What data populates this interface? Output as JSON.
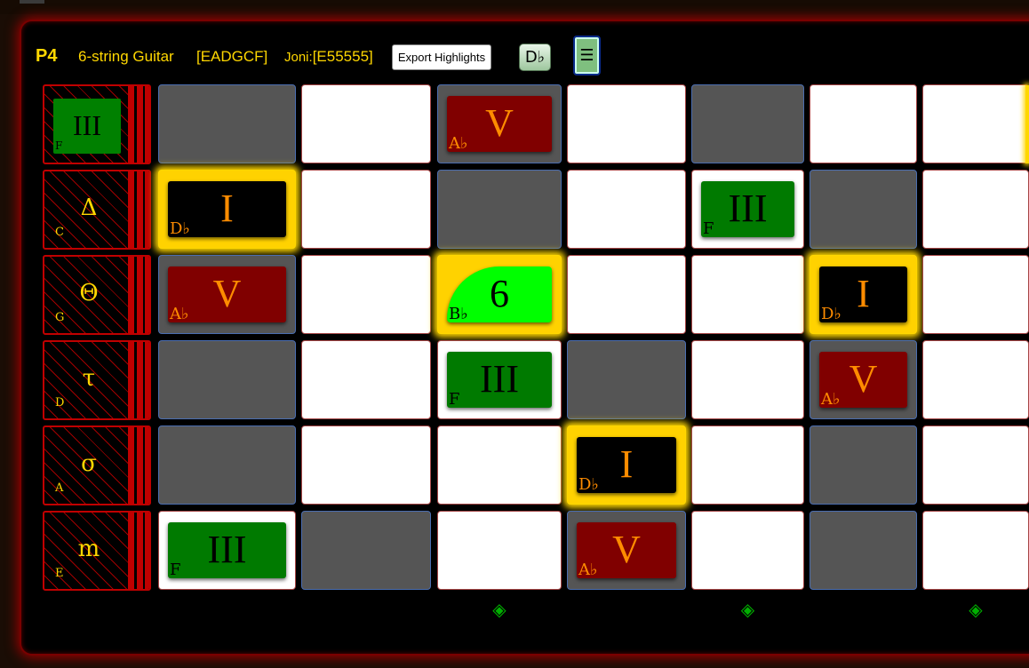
{
  "header": {
    "position": "P4",
    "instrument": "6-string Guitar",
    "tuning": "[EADGCF]",
    "joni_label": "Joni:",
    "joni_value": "[E55555]",
    "export_label": "Export Highlights",
    "key_label": "D♭",
    "menu_label": "☰"
  },
  "strings": [
    {
      "symbol": "",
      "note": "F",
      "chip": {
        "numeral": "III",
        "note": "F"
      }
    },
    {
      "symbol": "Δ",
      "note": "C"
    },
    {
      "symbol": "Θ",
      "note": "G"
    },
    {
      "symbol": "τ",
      "note": "D"
    },
    {
      "symbol": "σ",
      "note": "A"
    },
    {
      "symbol": "m",
      "note": "E"
    }
  ],
  "grid": [
    [
      {
        "bg": "gray"
      },
      {
        "bg": "white"
      },
      {
        "bg": "gray",
        "chip": {
          "kind": "red",
          "numeral": "V",
          "note": "A♭"
        }
      },
      {
        "bg": "white"
      },
      {
        "bg": "gray"
      },
      {
        "bg": "white"
      },
      {
        "bg": "white"
      }
    ],
    [
      {
        "bg": "glow",
        "chip": {
          "kind": "black",
          "numeral": "I",
          "note": "D♭"
        }
      },
      {
        "bg": "white"
      },
      {
        "bg": "gray"
      },
      {
        "bg": "white"
      },
      {
        "bg": "white",
        "chip": {
          "kind": "green",
          "numeral": "III",
          "note": "F"
        }
      },
      {
        "bg": "gray"
      },
      {
        "bg": "white"
      }
    ],
    [
      {
        "bg": "gray",
        "chip": {
          "kind": "red",
          "numeral": "V",
          "note": "A♭"
        }
      },
      {
        "bg": "white"
      },
      {
        "bg": "glow",
        "chip": {
          "kind": "lime",
          "numeral": "6",
          "note": "B♭"
        }
      },
      {
        "bg": "white"
      },
      {
        "bg": "white"
      },
      {
        "bg": "glow",
        "chip": {
          "kind": "black",
          "numeral": "I",
          "note": "D♭"
        }
      },
      {
        "bg": "white"
      }
    ],
    [
      {
        "bg": "gray"
      },
      {
        "bg": "white"
      },
      {
        "bg": "white",
        "chip": {
          "kind": "green",
          "numeral": "III",
          "note": "F"
        }
      },
      {
        "bg": "gray"
      },
      {
        "bg": "white"
      },
      {
        "bg": "gray",
        "chip": {
          "kind": "red",
          "numeral": "V",
          "note": "A♭"
        }
      },
      {
        "bg": "white"
      }
    ],
    [
      {
        "bg": "gray"
      },
      {
        "bg": "white"
      },
      {
        "bg": "white"
      },
      {
        "bg": "glow",
        "chip": {
          "kind": "black",
          "numeral": "I",
          "note": "D♭"
        }
      },
      {
        "bg": "white"
      },
      {
        "bg": "gray"
      },
      {
        "bg": "white"
      }
    ],
    [
      {
        "bg": "white",
        "chip": {
          "kind": "green",
          "numeral": "III",
          "note": "F"
        }
      },
      {
        "bg": "gray"
      },
      {
        "bg": "white"
      },
      {
        "bg": "gray",
        "chip": {
          "kind": "red",
          "numeral": "V",
          "note": "A♭"
        }
      },
      {
        "bg": "white"
      },
      {
        "bg": "gray"
      },
      {
        "bg": "white"
      }
    ]
  ],
  "markers": [
    "◈",
    "◈",
    "◈"
  ],
  "marker_columns": [
    2,
    4,
    6
  ],
  "colors": {
    "accent": "#ffd700",
    "frame": "#c00000",
    "green_marker": "#00b000"
  }
}
